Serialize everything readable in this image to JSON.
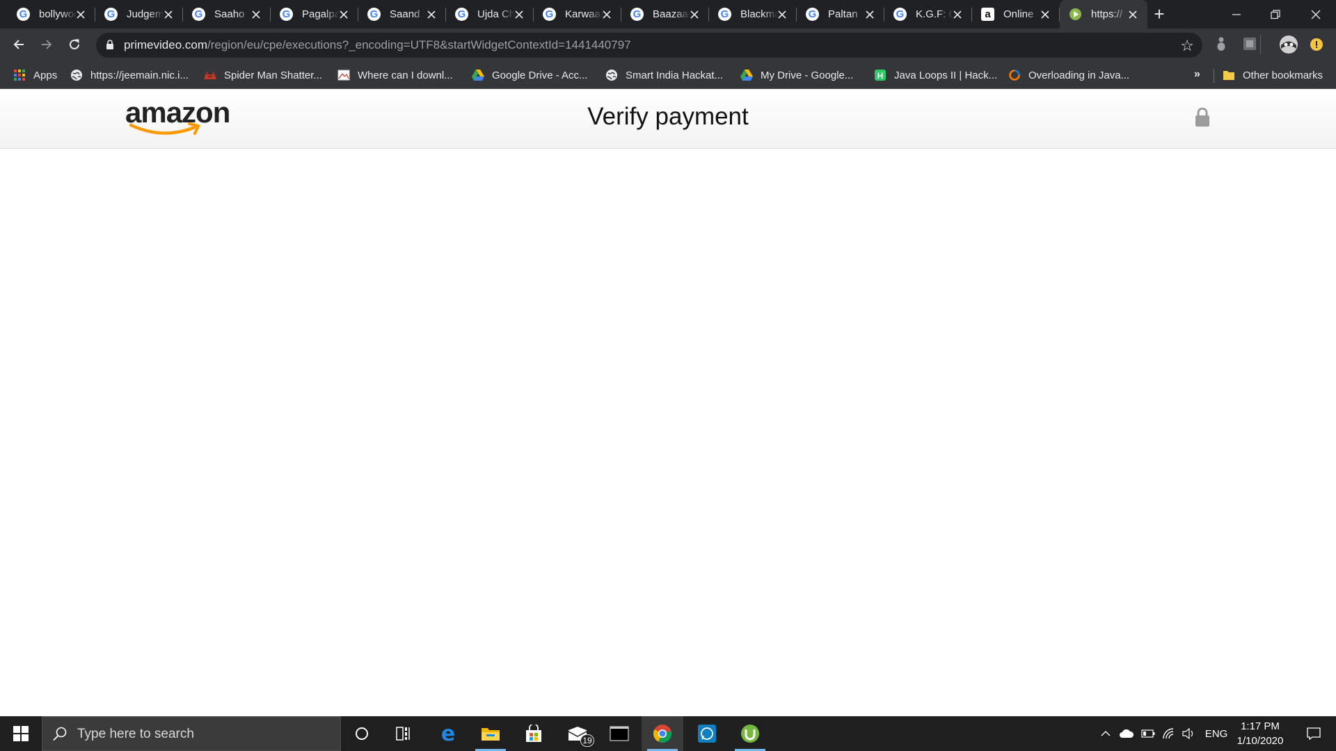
{
  "browser": {
    "tabs": [
      {
        "title": "bollywood",
        "favicon": "google-g-icon",
        "active": false
      },
      {
        "title": "Judgementall",
        "favicon": "google-g-icon",
        "active": false
      },
      {
        "title": "Saaho",
        "favicon": "google-g-icon",
        "active": false
      },
      {
        "title": "Pagalpanti",
        "favicon": "google-g-icon",
        "active": false
      },
      {
        "title": "Saand",
        "favicon": "google-g-icon",
        "active": false
      },
      {
        "title": "Ujda Chaman",
        "favicon": "google-g-icon",
        "active": false
      },
      {
        "title": "Karwaan",
        "favicon": "google-g-icon",
        "active": false
      },
      {
        "title": "Baazaar",
        "favicon": "google-g-icon",
        "active": false
      },
      {
        "title": "Blackmail",
        "favicon": "google-g-icon",
        "active": false
      },
      {
        "title": "Paltan",
        "favicon": "google-g-icon",
        "active": false
      },
      {
        "title": "K.G.F: Chapter",
        "favicon": "google-g-icon",
        "active": false
      },
      {
        "title": "Online",
        "favicon": "amazon-a-icon",
        "active": false
      },
      {
        "title": "https://",
        "favicon": "prime-video-play-icon",
        "active": true
      }
    ],
    "new_tab_label": "+",
    "window_controls": {
      "minimize": "minimize-icon",
      "restore": "restore-icon",
      "close": "close-icon"
    },
    "address": {
      "host": "primevideo.com",
      "path": "/region/eu/cpe/executions?_encoding=UTF8&startWidgetContextId=1441440797",
      "secure_icon": "lock-icon"
    },
    "bookmarks": [
      {
        "label": "Apps",
        "icon": "apps-grid-icon"
      },
      {
        "label": "https://jeemain.nic.i...",
        "icon": "globe-icon"
      },
      {
        "label": "Spider Man Shatter...",
        "icon": "spiderman-icon"
      },
      {
        "label": "Where can I downl...",
        "icon": "image-icon"
      },
      {
        "label": "Google Drive - Acc...",
        "icon": "google-drive-icon"
      },
      {
        "label": "Smart India Hackat...",
        "icon": "globe-icon"
      },
      {
        "label": "My Drive - Google...",
        "icon": "google-drive-icon"
      },
      {
        "label": "Java Loops II | Hack...",
        "icon": "hackerrank-icon"
      },
      {
        "label": "Overloading in Java...",
        "icon": "ring-icon"
      }
    ],
    "bookmarks_overflow": "»",
    "other_bookmarks": "Other bookmarks"
  },
  "page": {
    "logo_text": "amazon",
    "title": "Verify payment",
    "lock_icon": "padlock-icon"
  },
  "taskbar": {
    "search_placeholder": "Type here to search",
    "apps": [
      {
        "name": "cortana-icon"
      },
      {
        "name": "task-view-icon"
      },
      {
        "name": "edge-icon"
      },
      {
        "name": "file-explorer-icon"
      },
      {
        "name": "store-icon"
      },
      {
        "name": "mail-icon",
        "badge": "19"
      },
      {
        "name": "terminal-icon"
      },
      {
        "name": "chrome-icon"
      },
      {
        "name": "whatsapp-icon"
      },
      {
        "name": "utorrent-icon"
      }
    ],
    "language": "ENG",
    "time": "1:17 PM",
    "date": "1/10/2020"
  },
  "colors": {
    "tab_strip": "#202124",
    "toolbar": "#35363a",
    "amazon_orange": "#ff9900",
    "taskbar": "#1f1f1f"
  }
}
